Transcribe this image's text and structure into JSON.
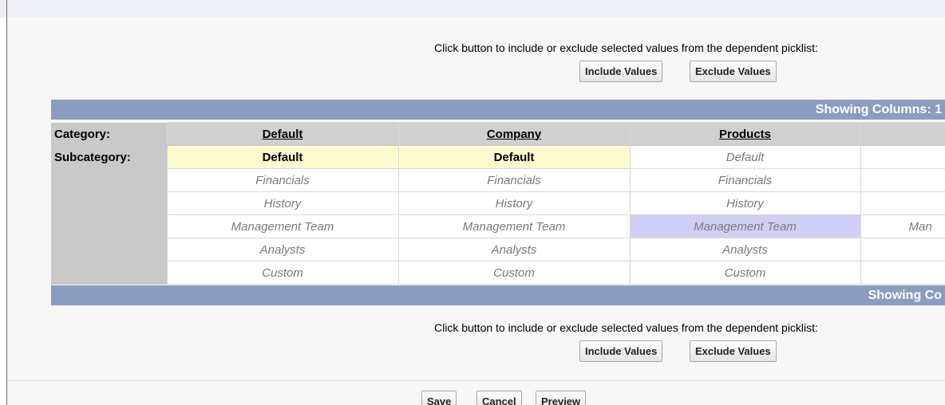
{
  "instruction_text": "Click button to include or exclude selected values from the dependent picklist:",
  "buttons": {
    "include": "Include Values",
    "exclude": "Exclude Values",
    "save": "Save",
    "cancel": "Cancel",
    "preview": "Preview"
  },
  "showing_top": "Showing Columns: 1",
  "showing_bottom": "Showing Co",
  "labels": {
    "category": "Category:",
    "subcategory": "Subcategory:"
  },
  "columns": [
    {
      "category": "Default",
      "values": [
        "Default",
        "Financials",
        "History",
        "Management Team",
        "Analysts",
        "Custom"
      ],
      "selected": [
        0
      ]
    },
    {
      "category": "Company",
      "values": [
        "Default",
        "Financials",
        "History",
        "Management Team",
        "Analysts",
        "Custom"
      ],
      "selected": [
        0
      ]
    },
    {
      "category": "Products",
      "values": [
        "Default",
        "Financials",
        "History",
        "Management Team",
        "Analysts",
        "Custom"
      ],
      "selected": []
    },
    {
      "category": "",
      "values": [
        "",
        "",
        "",
        "Man",
        "",
        ""
      ],
      "selected": []
    }
  ],
  "highlight": {
    "col": 2,
    "row": 3
  },
  "colors": {
    "bar": "#8a9cbf",
    "selected": "#fdfbd0",
    "highlight": "#cfcff5"
  }
}
